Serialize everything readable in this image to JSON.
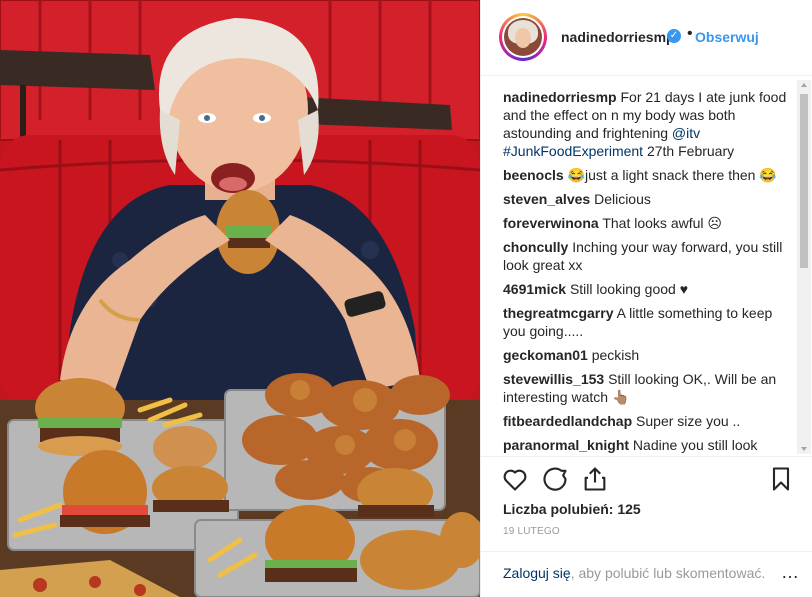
{
  "post": {
    "username": "nadinedorriesmp",
    "follow_label": "Obserwuj",
    "caption": {
      "user": "nadinedorriesmp",
      "text_before": "For 21 days I ate junk food and the effect on n my body was both astounding and frightening ",
      "mention": "@itv",
      "hashtag": "#JunkFoodExperiment",
      "text_after": " 27th February"
    },
    "comments": [
      {
        "user": "beenocls",
        "text": "😂just a light snack there then 😂"
      },
      {
        "user": "steven_alves",
        "text": "Delicious"
      },
      {
        "user": "foreverwinona",
        "text": "That looks awful ☹"
      },
      {
        "user": "choncully",
        "text": "Inching your way forward, you still look great xx"
      },
      {
        "user": "4691mick",
        "text": "Still looking good ♥"
      },
      {
        "user": "thegreatmcgarry",
        "text": "A little something to keep you going....."
      },
      {
        "user": "geckoman01",
        "text": "peckish"
      },
      {
        "user": "stevewillis_153",
        "text": "Still looking OK,. Will be an interesting watch 👆🏽"
      },
      {
        "user": "fitbeardedlandchap",
        "text": "Super size you .."
      },
      {
        "user": "paranormal_knight",
        "text": "Nadine you still look"
      }
    ],
    "likes_text": "Liczba polubień: 125",
    "date": "19 LUTEGO",
    "footer": {
      "login_link": "Zaloguj się",
      "login_rest": ", aby polubić lub skomentować."
    },
    "icons": [
      "heart-icon",
      "comment-icon",
      "share-icon",
      "bookmark-icon",
      "more-options-icon",
      "verified-badge-icon"
    ],
    "colors": {
      "link": "#003569",
      "follow": "#3897f0",
      "verified": "#3897f0",
      "muted": "#999999",
      "text": "#262626"
    }
  }
}
